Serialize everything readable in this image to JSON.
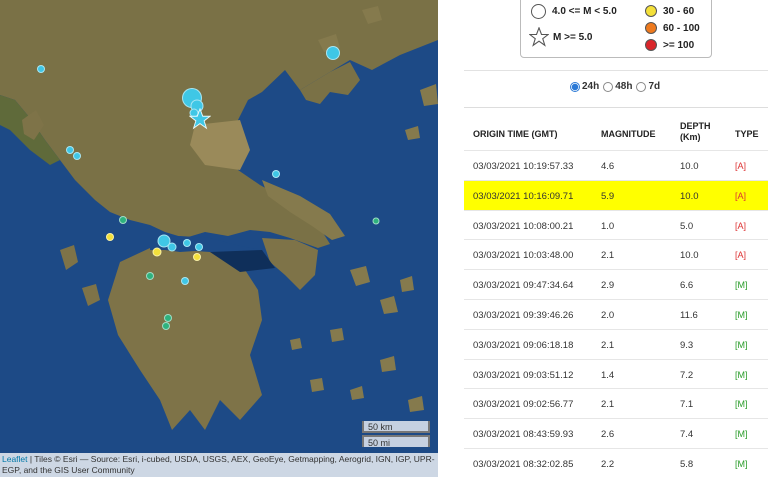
{
  "map": {
    "scale_km": "50 km",
    "scale_mi": "50 mi",
    "attribution_link": "Leaflet",
    "attribution_text": " | Tiles © Esri — Source: Esri, i-cubed, USDA, USGS, AEX, GeoEye, Getmapping, Aerogrid, IGN, IGP, UPR-EGP, and the GIS User Community",
    "colors": {
      "sea": "#1d4a86",
      "quake_cyan": "#3fc7e6",
      "quake_green": "#2eb27e",
      "quake_yellow": "#f3e03b"
    }
  },
  "legend": {
    "mag_medium": "4.0 <= M < 5.0",
    "mag_large": "M >= 5.0",
    "depth_1": "30 - 60",
    "depth_2": "60 - 100",
    "depth_3": ">= 100",
    "depth_colors": [
      "#f4e03a",
      "#ee7a1e",
      "#d9262a"
    ]
  },
  "range_options": [
    {
      "label": "24h",
      "selected": true
    },
    {
      "label": "48h",
      "selected": false
    },
    {
      "label": "7d",
      "selected": false
    }
  ],
  "table": {
    "headers": {
      "origin_time": "ORIGIN TIME (GMT)",
      "magnitude": "MAGNITUDE",
      "depth_1": "DEPTH",
      "depth_2": "(Km)",
      "type": "TYPE"
    },
    "highlight_color": "#ffff00",
    "rows": [
      {
        "time": "03/03/2021 10:19:57.33",
        "mag": "4.6",
        "depth": "10.0",
        "type": "[A]"
      },
      {
        "time": "03/03/2021 10:16:09.71",
        "mag": "5.9",
        "depth": "10.0",
        "type": "[A]"
      },
      {
        "time": "03/03/2021 10:08:00.21",
        "mag": "1.0",
        "depth": "5.0",
        "type": "[A]"
      },
      {
        "time": "03/03/2021 10:03:48.00",
        "mag": "2.1",
        "depth": "10.0",
        "type": "[A]"
      },
      {
        "time": "03/03/2021 09:47:34.64",
        "mag": "2.9",
        "depth": "6.6",
        "type": "[M]"
      },
      {
        "time": "03/03/2021 09:39:46.26",
        "mag": "2.0",
        "depth": "11.6",
        "type": "[M]"
      },
      {
        "time": "03/03/2021 09:06:18.18",
        "mag": "2.1",
        "depth": "9.3",
        "type": "[M]"
      },
      {
        "time": "03/03/2021 09:03:51.12",
        "mag": "1.4",
        "depth": "7.2",
        "type": "[M]"
      },
      {
        "time": "03/03/2021 09:02:56.77",
        "mag": "2.1",
        "depth": "7.1",
        "type": "[M]"
      },
      {
        "time": "03/03/2021 08:43:59.93",
        "mag": "2.6",
        "depth": "7.4",
        "type": "[M]"
      },
      {
        "time": "03/03/2021 08:32:02.85",
        "mag": "2.2",
        "depth": "5.8",
        "type": "[M]"
      }
    ]
  }
}
